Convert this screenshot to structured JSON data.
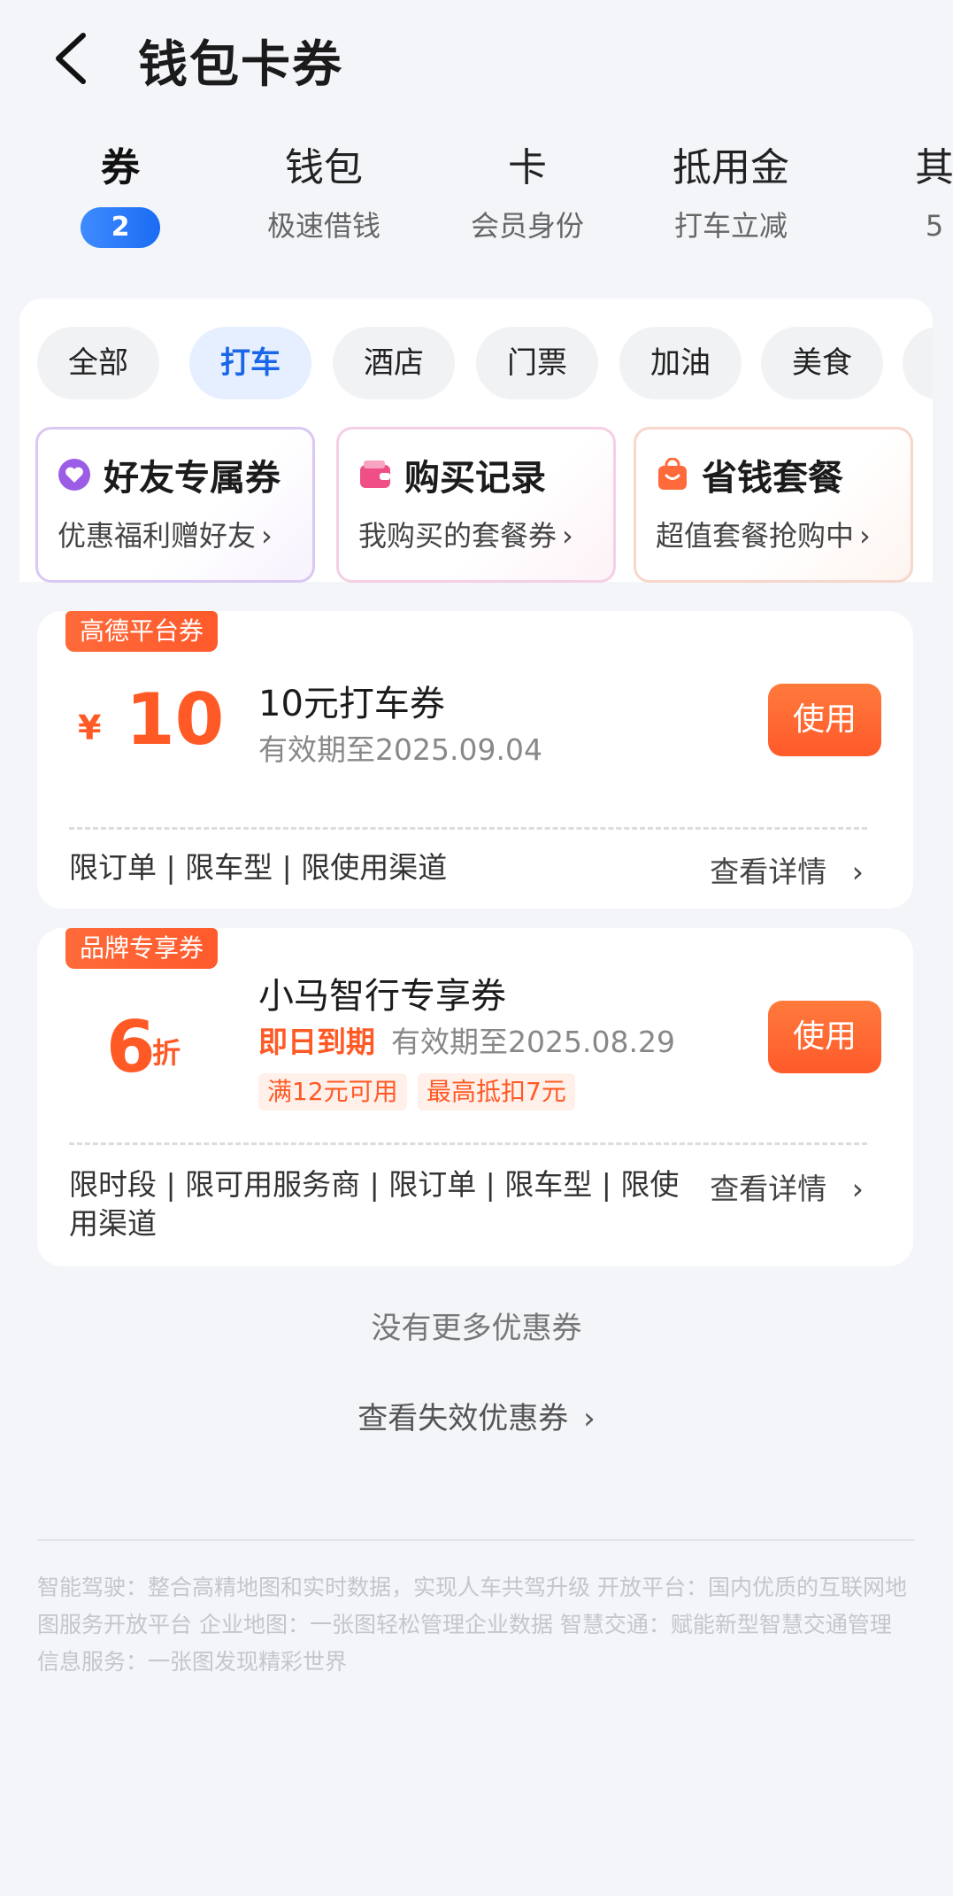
{
  "header": {
    "title": "钱包卡券"
  },
  "categories": [
    {
      "main": "券",
      "badge": "2",
      "active": true
    },
    {
      "main": "钱包",
      "sub": "极速借钱"
    },
    {
      "main": "卡",
      "sub": "会员身份"
    },
    {
      "main": "抵用金",
      "sub": "打车立减"
    },
    {
      "main": "其",
      "sub": "5"
    }
  ],
  "filters": [
    "全部",
    "打车",
    "酒店",
    "门票",
    "加油",
    "美食"
  ],
  "promos": [
    {
      "title": "好友专属券",
      "sub": "优惠福利赠好友",
      "icon": "heart-icon",
      "border": "#d9c8f3",
      "icon_color": "#9b5de5"
    },
    {
      "title": "购买记录",
      "sub": "我购买的套餐券",
      "icon": "wallet-icon",
      "border": "#f4cfe6",
      "icon_color": "#ef4f86"
    },
    {
      "title": "省钱套餐",
      "sub": "超值套餐抢购中",
      "icon": "shopping-bag-icon",
      "border": "#f7d6cc",
      "icon_color": "#ff6a3a"
    }
  ],
  "coupons": [
    {
      "tag": "高德平台券",
      "currency": "¥",
      "amount": "10",
      "name": "10元打车券",
      "validity": "有效期至2025.09.04",
      "use_label": "使用",
      "limits": "限订单 | 限车型 | 限使用渠道",
      "detail_label": "查看详情"
    },
    {
      "tag": "品牌专享券",
      "discount": "6",
      "discount_unit": "折",
      "name": "小马智行专享券",
      "urgent": "即日到期",
      "validity": "有效期至2025.08.29",
      "conditions": [
        "满12元可用",
        "最高抵扣7元"
      ],
      "use_label": "使用",
      "limits": "限时段 | 限可用服务商 | 限订单 | 限车型 | 限使用渠道",
      "detail_label": "查看详情"
    }
  ],
  "no_more": "没有更多优惠券",
  "view_expired": "查看失效优惠券",
  "footer": "智能驾驶：整合高精地图和实时数据，实现人车共驾升级 开放平台：国内优质的互联网地图服务开放平台 企业地图：一张图轻松管理企业数据 智慧交通：赋能新型智慧交通管理 信息服务：一张图发现精彩世界",
  "colors": {
    "accent": "#1a66e8",
    "orange": "#ff5a25"
  }
}
